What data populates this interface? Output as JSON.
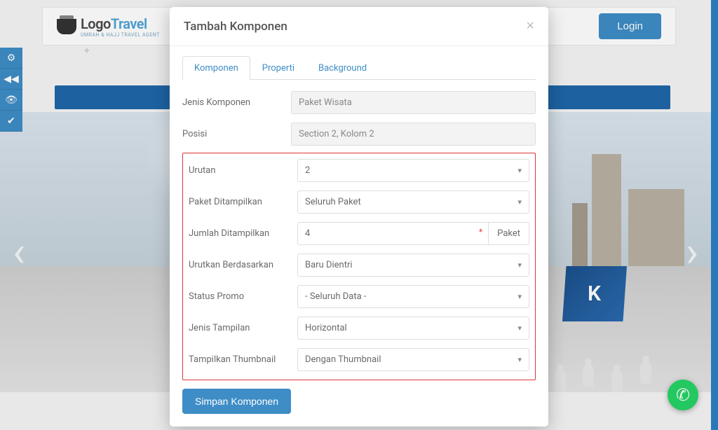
{
  "header": {
    "logo_main_left": "Logo",
    "logo_main_right": "Travel",
    "logo_sub": "UMRAH & HAJJ TRAVEL AGENT",
    "login_label": "Login",
    "plus": "+"
  },
  "side_tools": [
    "⚙",
    "◀◀",
    "👁",
    "✔"
  ],
  "hero": {
    "banner_text": "K",
    "arrow_left": "‹",
    "arrow_right": "›",
    "whatsapp_icon": "✆"
  },
  "modal": {
    "title": "Tambah Komponen",
    "close": "×",
    "tabs": {
      "komponen": "Komponen",
      "properti": "Properti",
      "background": "Background"
    },
    "labels": {
      "jenis_komponen": "Jenis Komponen",
      "posisi": "Posisi",
      "urutan": "Urutan",
      "paket_ditampilkan": "Paket Ditampilkan",
      "jumlah_ditampilkan": "Jumlah Ditampilkan",
      "urutkan_berdasarkan": "Urutkan Berdasarkan",
      "status_promo": "Status Promo",
      "jenis_tampilan": "Jenis Tampilan",
      "tampilkan_thumbnail": "Tampilkan Thumbnail"
    },
    "values": {
      "jenis_komponen": "Paket Wisata",
      "posisi": "Section 2, Kolom 2",
      "urutan": "2",
      "paket_ditampilkan": "Seluruh Paket",
      "jumlah_ditampilkan": "4",
      "jumlah_unit": "Paket",
      "urutkan_berdasarkan": "Baru Dientri",
      "status_promo": "- Seluruh Data -",
      "jenis_tampilan": "Horizontal",
      "tampilkan_thumbnail": "Dengan Thumbnail"
    },
    "save_label": "Simpan Komponen"
  }
}
